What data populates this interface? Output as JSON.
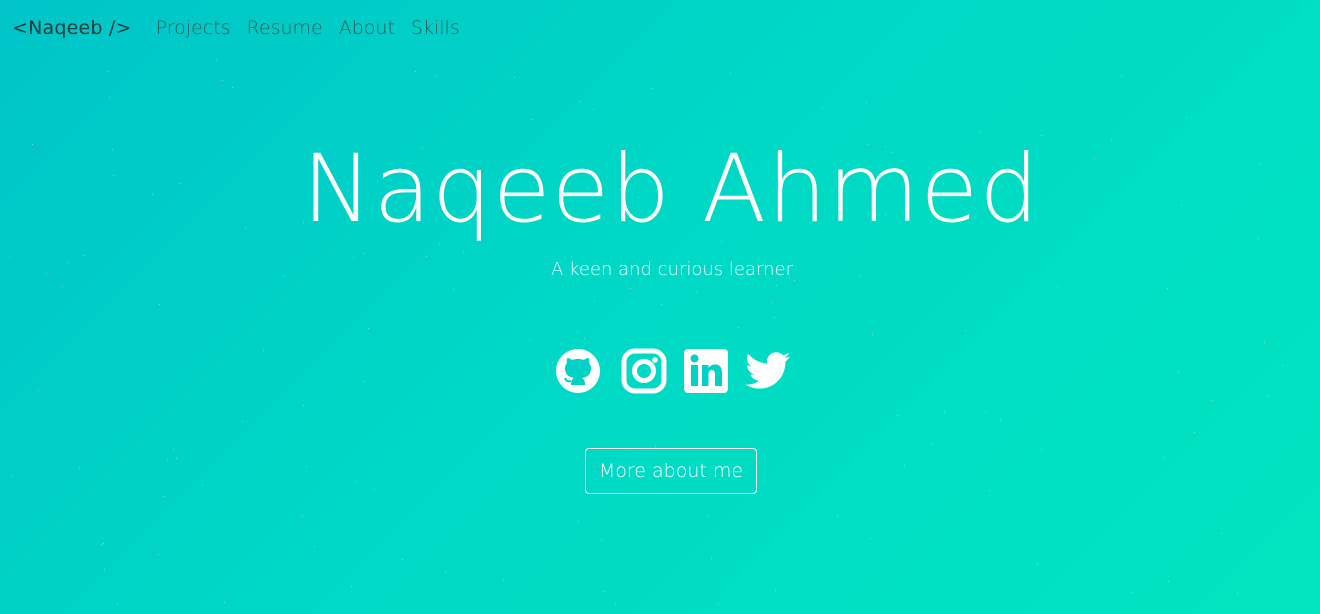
{
  "navbar": {
    "brand": "<Naqeeb />",
    "links": [
      {
        "label": "Projects"
      },
      {
        "label": "Resume"
      },
      {
        "label": "About"
      },
      {
        "label": "Skills"
      }
    ]
  },
  "hero": {
    "name": "Naqeeb Ahmed",
    "tagline": "A keen and curious learner",
    "socials": [
      {
        "icon": "github-icon"
      },
      {
        "icon": "instagram-icon"
      },
      {
        "icon": "linkedin-icon"
      },
      {
        "icon": "twitter-icon"
      }
    ],
    "more_button": "More about me"
  },
  "colors": {
    "background_start": "#00c4c8",
    "background_end": "#00e5c0",
    "text": "#ffffff",
    "brand_text": "#1f3a3a",
    "nav_text": "#2c5c5a"
  }
}
